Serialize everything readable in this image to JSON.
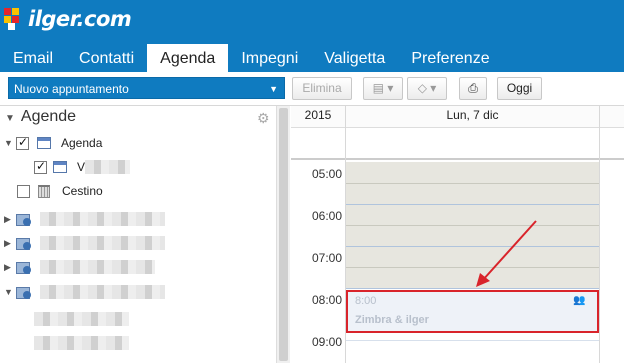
{
  "brand": {
    "name": "ilger.com",
    "colors": {
      "primary": "#0f7bc0",
      "highlight": "#d9242b"
    }
  },
  "tabs": [
    {
      "label": "Email"
    },
    {
      "label": "Contatti"
    },
    {
      "label": "Agenda",
      "active": true
    },
    {
      "label": "Impegni"
    },
    {
      "label": "Valigetta"
    },
    {
      "label": "Preferenze"
    }
  ],
  "toolbar": {
    "new_label": "Nuovo appuntamento",
    "delete_label": "Elimina",
    "today_label": "Oggi",
    "icons": [
      "move-icon",
      "tag-icon",
      "print-icon"
    ]
  },
  "sidebar": {
    "heading": "Agende",
    "items": [
      {
        "label": "Agenda",
        "checked": true
      },
      {
        "label": "V",
        "checked": true
      },
      {
        "label": "Cestino",
        "checked": false
      }
    ]
  },
  "calendar": {
    "year": "2015",
    "day": "Lun, 7 dic",
    "hours": [
      "05:00",
      "06:00",
      "07:00",
      "08:00",
      "09:00"
    ],
    "appointment": {
      "time": "8:00",
      "title": "Zimbra & ilger"
    }
  }
}
